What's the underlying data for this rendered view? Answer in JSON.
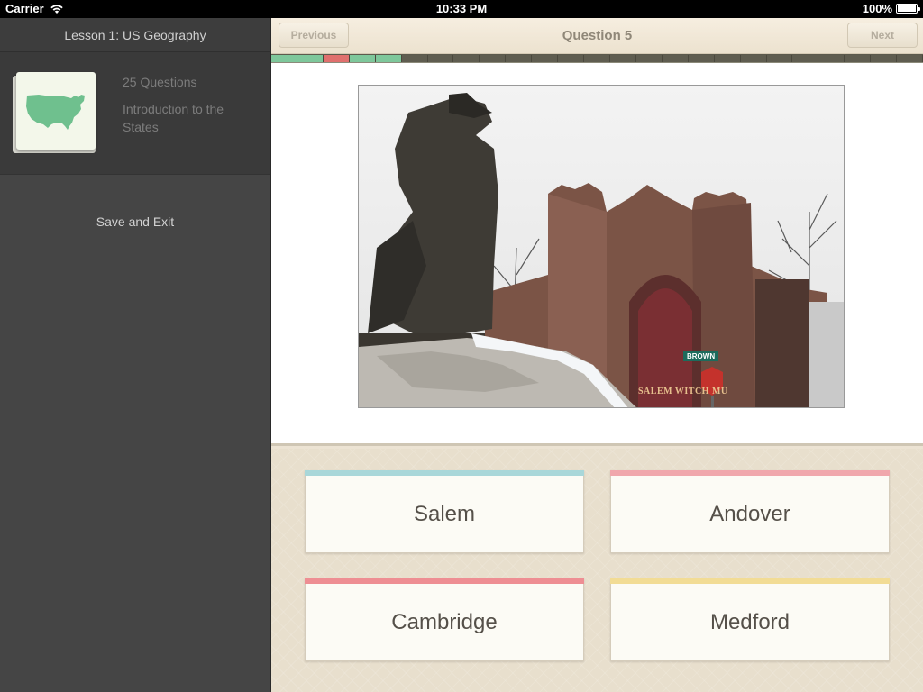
{
  "status_bar": {
    "carrier": "Carrier",
    "time": "10:33 PM",
    "battery": "100%"
  },
  "sidebar": {
    "header": "Lesson 1: US Geography",
    "lesson": {
      "question_count": "25 Questions",
      "description": "Introduction to the States",
      "thumbnail_icon": "usa-map-icon",
      "thumbnail_color": "#6fc08e"
    },
    "save_exit_label": "Save and Exit"
  },
  "navbar": {
    "previous_label": "Previous",
    "title": "Question 5",
    "next_label": "Next"
  },
  "progress": {
    "total": 25,
    "results": [
      "correct",
      "correct",
      "wrong",
      "correct",
      "correct"
    ],
    "colors": {
      "correct": "#7ec79b",
      "wrong": "#e0706e",
      "empty": "#5f5d50"
    }
  },
  "photo": {
    "street_sign": "BROWN",
    "museum_sign": "SALEM WITCH MU"
  },
  "answers": [
    {
      "label": "Salem",
      "accent": "#a9d7d9"
    },
    {
      "label": "Andover",
      "accent": "#f0a7ac"
    },
    {
      "label": "Cambridge",
      "accent": "#ee8e93"
    },
    {
      "label": "Medford",
      "accent": "#f2dc95"
    }
  ]
}
